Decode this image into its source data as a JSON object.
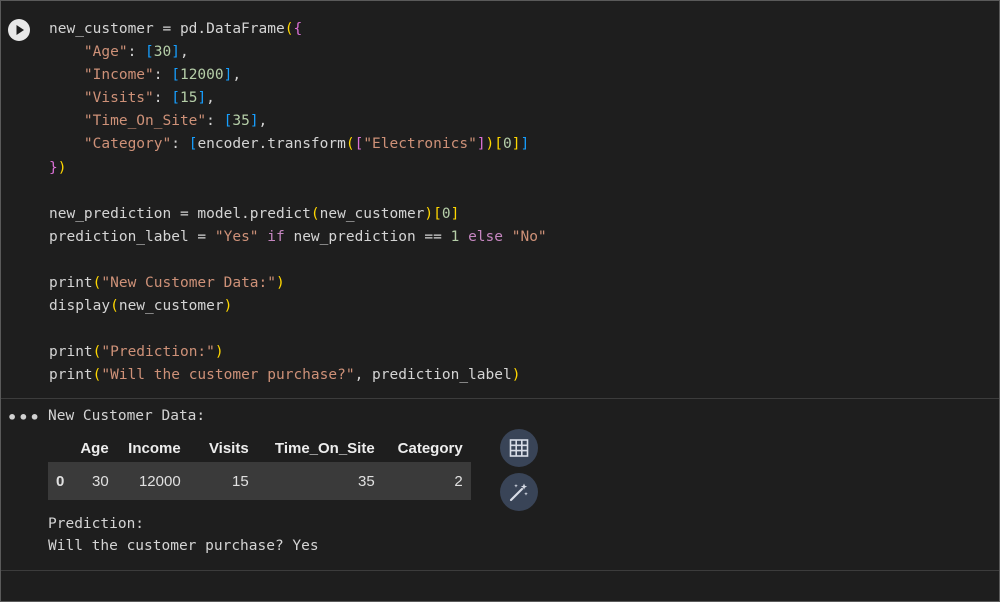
{
  "code_lines": [
    [
      [
        "t-fn",
        "new_customer = pd.DataFrame"
      ],
      [
        "t-b1",
        "("
      ],
      [
        "t-b2",
        "{"
      ]
    ],
    [
      [
        "t-fn",
        "    "
      ],
      [
        "t-str",
        "\"Age\""
      ],
      [
        "t-fn",
        ": "
      ],
      [
        "t-b3",
        "["
      ],
      [
        "t-num",
        "30"
      ],
      [
        "t-b3",
        "]"
      ],
      [
        "t-fn",
        ","
      ]
    ],
    [
      [
        "t-fn",
        "    "
      ],
      [
        "t-str",
        "\"Income\""
      ],
      [
        "t-fn",
        ": "
      ],
      [
        "t-b3",
        "["
      ],
      [
        "t-num",
        "12000"
      ],
      [
        "t-b3",
        "]"
      ],
      [
        "t-fn",
        ","
      ]
    ],
    [
      [
        "t-fn",
        "    "
      ],
      [
        "t-str",
        "\"Visits\""
      ],
      [
        "t-fn",
        ": "
      ],
      [
        "t-b3",
        "["
      ],
      [
        "t-num",
        "15"
      ],
      [
        "t-b3",
        "]"
      ],
      [
        "t-fn",
        ","
      ]
    ],
    [
      [
        "t-fn",
        "    "
      ],
      [
        "t-str",
        "\"Time_On_Site\""
      ],
      [
        "t-fn",
        ": "
      ],
      [
        "t-b3",
        "["
      ],
      [
        "t-num",
        "35"
      ],
      [
        "t-b3",
        "]"
      ],
      [
        "t-fn",
        ","
      ]
    ],
    [
      [
        "t-fn",
        "    "
      ],
      [
        "t-str",
        "\"Category\""
      ],
      [
        "t-fn",
        ": "
      ],
      [
        "t-b3",
        "["
      ],
      [
        "t-fn",
        "encoder.transform"
      ],
      [
        "t-b1",
        "("
      ],
      [
        "t-b2",
        "["
      ],
      [
        "t-str",
        "\"Electronics\""
      ],
      [
        "t-b2",
        "]"
      ],
      [
        "t-b1",
        ")"
      ],
      [
        "t-b1",
        "["
      ],
      [
        "t-num",
        "0"
      ],
      [
        "t-b1",
        "]"
      ],
      [
        "t-b3",
        "]"
      ]
    ],
    [
      [
        "t-b2",
        "}"
      ],
      [
        "t-b1",
        ")"
      ]
    ],
    [],
    [
      [
        "t-fn",
        "new_prediction = model.predict"
      ],
      [
        "t-b1",
        "("
      ],
      [
        "t-fn",
        "new_customer"
      ],
      [
        "t-b1",
        ")"
      ],
      [
        "t-b1",
        "["
      ],
      [
        "t-num",
        "0"
      ],
      [
        "t-b1",
        "]"
      ]
    ],
    [
      [
        "t-fn",
        "prediction_label = "
      ],
      [
        "t-str",
        "\"Yes\""
      ],
      [
        "t-fn",
        " "
      ],
      [
        "t-kw",
        "if"
      ],
      [
        "t-fn",
        " new_prediction == "
      ],
      [
        "t-num",
        "1"
      ],
      [
        "t-fn",
        " "
      ],
      [
        "t-kw",
        "else"
      ],
      [
        "t-fn",
        " "
      ],
      [
        "t-str",
        "\"No\""
      ]
    ],
    [],
    [
      [
        "t-fn",
        "print"
      ],
      [
        "t-b1",
        "("
      ],
      [
        "t-str",
        "\"New Customer Data:\""
      ],
      [
        "t-b1",
        ")"
      ]
    ],
    [
      [
        "t-fn",
        "display"
      ],
      [
        "t-b1",
        "("
      ],
      [
        "t-fn",
        "new_customer"
      ],
      [
        "t-b1",
        ")"
      ]
    ],
    [],
    [
      [
        "t-fn",
        "print"
      ],
      [
        "t-b1",
        "("
      ],
      [
        "t-str",
        "\"Prediction:\""
      ],
      [
        "t-b1",
        ")"
      ]
    ],
    [
      [
        "t-fn",
        "print"
      ],
      [
        "t-b1",
        "("
      ],
      [
        "t-str",
        "\"Will the customer purchase?\""
      ],
      [
        "t-fn",
        ", prediction_label"
      ],
      [
        "t-b1",
        ")"
      ]
    ]
  ],
  "output": {
    "menu_glyph": "•••",
    "line1": "New Customer Data:",
    "line2": "Prediction:",
    "line3": "Will the customer purchase? Yes"
  },
  "dataframe": {
    "columns": [
      "Age",
      "Income",
      "Visits",
      "Time_On_Site",
      "Category"
    ],
    "index": "0",
    "row": [
      "30",
      "12000",
      "15",
      "35",
      "2"
    ]
  },
  "icons": {
    "run": "play-circle-icon",
    "table": "table-icon",
    "magic": "magic-wand-icon"
  }
}
